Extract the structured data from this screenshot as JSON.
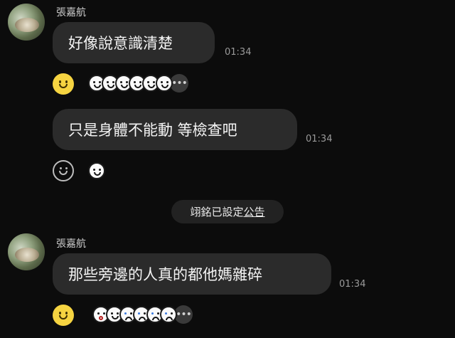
{
  "messages": [
    {
      "sender": "張嘉航",
      "text": "好像說意識清楚",
      "time": "01:34",
      "reaction_button": "smile-filled",
      "stickers": [
        "thumb-smile",
        "smile",
        "smile",
        "smile",
        "smile",
        "smile"
      ],
      "more": "•••"
    },
    {
      "text": "只是身體不能動 等檢查吧",
      "time": "01:34",
      "reaction_button": "smile-outline",
      "stickers": [
        "thumb-smile"
      ]
    },
    {
      "sender": "張嘉航",
      "text": "那些旁邊的人真的都他媽雜碎",
      "time": "01:34",
      "reaction_button": "smile-filled",
      "stickers": [
        "shock",
        "smile",
        "cry",
        "cry",
        "cry",
        "cry"
      ],
      "more": "•••"
    }
  ],
  "system_notice": {
    "prefix": "翊銘已設定",
    "link": "公告"
  },
  "colors": {
    "background": "#0c0c0c",
    "bubble": "#2b2b2b",
    "text": "#f4f4f4",
    "timestamp": "#9a9a9a",
    "reaction_yellow": "#f6d441"
  }
}
